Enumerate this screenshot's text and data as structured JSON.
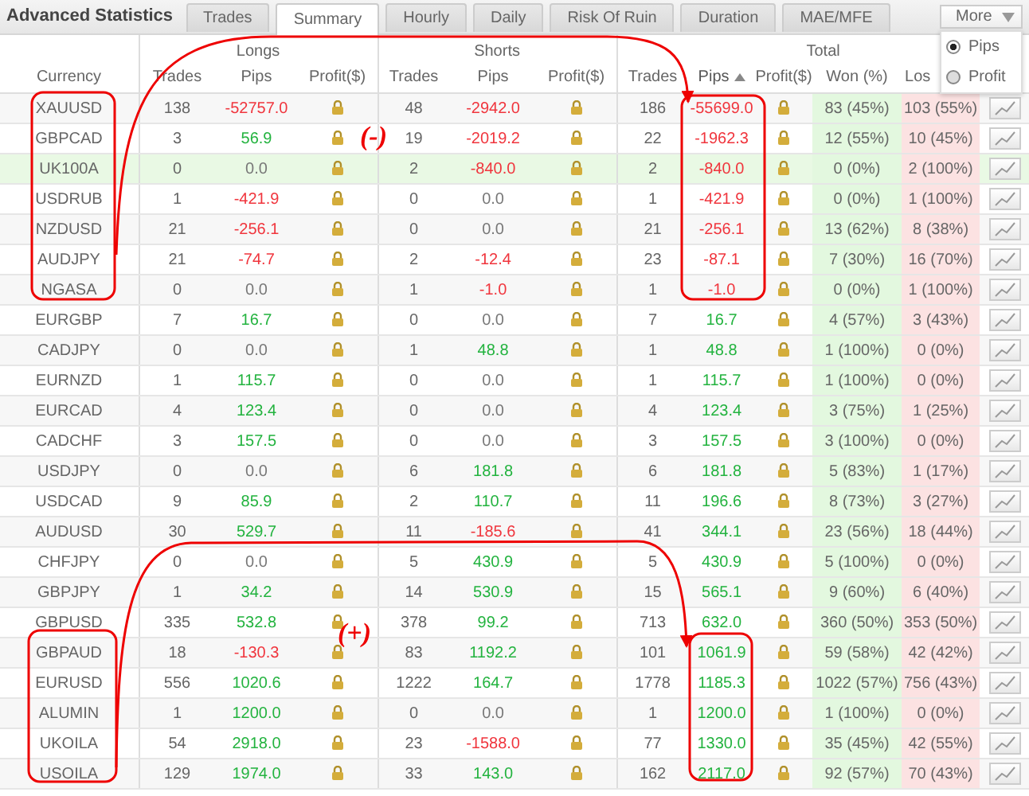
{
  "title": "Advanced Statistics",
  "tabs": [
    {
      "label": "Trades",
      "selected": false
    },
    {
      "label": "Summary",
      "selected": true
    },
    {
      "label": "Hourly",
      "selected": false
    },
    {
      "label": "Daily",
      "selected": false
    },
    {
      "label": "Risk Of Ruin",
      "selected": false
    },
    {
      "label": "Duration",
      "selected": false
    },
    {
      "label": "MAE/MFE",
      "selected": false
    }
  ],
  "more_menu": {
    "label": "More",
    "options": [
      {
        "label": "Pips",
        "selected": true
      },
      {
        "label": "Profit",
        "selected": false
      }
    ]
  },
  "groups": [
    "Longs",
    "Shorts",
    "Total"
  ],
  "columns": {
    "currency": "Currency",
    "longs": [
      "Trades",
      "Pips",
      "Profit($)"
    ],
    "shorts": [
      "Trades",
      "Pips",
      "Profit($)"
    ],
    "total": [
      {
        "label": "Trades",
        "sorted": false
      },
      {
        "label": "Pips",
        "sorted": true
      },
      {
        "label": "Profit($)",
        "sorted": false
      },
      {
        "label": "Won (%)",
        "sorted": false
      },
      {
        "label": "Los",
        "sorted": false
      }
    ]
  },
  "rows": [
    {
      "currency": "XAUUSD",
      "highlighted": false,
      "longs": {
        "trades": "138",
        "pips": "-52757.0",
        "color": "#f0353d"
      },
      "shorts": {
        "trades": "48",
        "pips": "-2942.0",
        "color": "#f0353d"
      },
      "total": {
        "trades": "186",
        "pips": "-55699.0",
        "color": "#f0353d",
        "won": "83 (45%)",
        "lost": "103 (55%)"
      }
    },
    {
      "currency": "GBPCAD",
      "highlighted": false,
      "longs": {
        "trades": "3",
        "pips": "56.9",
        "color": "#23b33f"
      },
      "shorts": {
        "trades": "19",
        "pips": "-2019.2",
        "color": "#f0353d"
      },
      "total": {
        "trades": "22",
        "pips": "-1962.3",
        "color": "#f0353d",
        "won": "12 (55%)",
        "lost": "10 (45%)"
      }
    },
    {
      "currency": "UK100A",
      "highlighted": true,
      "longs": {
        "trades": "0",
        "pips": "0.0",
        "color": "#777777"
      },
      "shorts": {
        "trades": "2",
        "pips": "-840.0",
        "color": "#f0353d"
      },
      "total": {
        "trades": "2",
        "pips": "-840.0",
        "color": "#f0353d",
        "won": "0 (0%)",
        "lost": "2 (100%)"
      }
    },
    {
      "currency": "USDRUB",
      "highlighted": false,
      "longs": {
        "trades": "1",
        "pips": "-421.9",
        "color": "#f0353d"
      },
      "shorts": {
        "trades": "0",
        "pips": "0.0",
        "color": "#777777"
      },
      "total": {
        "trades": "1",
        "pips": "-421.9",
        "color": "#f0353d",
        "won": "0 (0%)",
        "lost": "1 (100%)"
      }
    },
    {
      "currency": "NZDUSD",
      "highlighted": false,
      "longs": {
        "trades": "21",
        "pips": "-256.1",
        "color": "#f0353d"
      },
      "shorts": {
        "trades": "0",
        "pips": "0.0",
        "color": "#777777"
      },
      "total": {
        "trades": "21",
        "pips": "-256.1",
        "color": "#f0353d",
        "won": "13 (62%)",
        "lost": "8 (38%)"
      }
    },
    {
      "currency": "AUDJPY",
      "highlighted": false,
      "longs": {
        "trades": "21",
        "pips": "-74.7",
        "color": "#f0353d"
      },
      "shorts": {
        "trades": "2",
        "pips": "-12.4",
        "color": "#f0353d"
      },
      "total": {
        "trades": "23",
        "pips": "-87.1",
        "color": "#f0353d",
        "won": "7 (30%)",
        "lost": "16 (70%)"
      }
    },
    {
      "currency": "NGASA",
      "highlighted": false,
      "longs": {
        "trades": "0",
        "pips": "0.0",
        "color": "#777777"
      },
      "shorts": {
        "trades": "1",
        "pips": "-1.0",
        "color": "#f0353d"
      },
      "total": {
        "trades": "1",
        "pips": "-1.0",
        "color": "#f0353d",
        "won": "0 (0%)",
        "lost": "1 (100%)"
      }
    },
    {
      "currency": "EURGBP",
      "highlighted": false,
      "longs": {
        "trades": "7",
        "pips": "16.7",
        "color": "#23b33f"
      },
      "shorts": {
        "trades": "0",
        "pips": "0.0",
        "color": "#777777"
      },
      "total": {
        "trades": "7",
        "pips": "16.7",
        "color": "#23b33f",
        "won": "4 (57%)",
        "lost": "3 (43%)"
      }
    },
    {
      "currency": "CADJPY",
      "highlighted": false,
      "longs": {
        "trades": "0",
        "pips": "0.0",
        "color": "#777777"
      },
      "shorts": {
        "trades": "1",
        "pips": "48.8",
        "color": "#23b33f"
      },
      "total": {
        "trades": "1",
        "pips": "48.8",
        "color": "#23b33f",
        "won": "1 (100%)",
        "lost": "0 (0%)"
      }
    },
    {
      "currency": "EURNZD",
      "highlighted": false,
      "longs": {
        "trades": "1",
        "pips": "115.7",
        "color": "#23b33f"
      },
      "shorts": {
        "trades": "0",
        "pips": "0.0",
        "color": "#777777"
      },
      "total": {
        "trades": "1",
        "pips": "115.7",
        "color": "#23b33f",
        "won": "1 (100%)",
        "lost": "0 (0%)"
      }
    },
    {
      "currency": "EURCAD",
      "highlighted": false,
      "longs": {
        "trades": "4",
        "pips": "123.4",
        "color": "#23b33f"
      },
      "shorts": {
        "trades": "0",
        "pips": "0.0",
        "color": "#777777"
      },
      "total": {
        "trades": "4",
        "pips": "123.4",
        "color": "#23b33f",
        "won": "3 (75%)",
        "lost": "1 (25%)"
      }
    },
    {
      "currency": "CADCHF",
      "highlighted": false,
      "longs": {
        "trades": "3",
        "pips": "157.5",
        "color": "#23b33f"
      },
      "shorts": {
        "trades": "0",
        "pips": "0.0",
        "color": "#777777"
      },
      "total": {
        "trades": "3",
        "pips": "157.5",
        "color": "#23b33f",
        "won": "3 (100%)",
        "lost": "0 (0%)"
      }
    },
    {
      "currency": "USDJPY",
      "highlighted": false,
      "longs": {
        "trades": "0",
        "pips": "0.0",
        "color": "#777777"
      },
      "shorts": {
        "trades": "6",
        "pips": "181.8",
        "color": "#23b33f"
      },
      "total": {
        "trades": "6",
        "pips": "181.8",
        "color": "#23b33f",
        "won": "5 (83%)",
        "lost": "1 (17%)"
      }
    },
    {
      "currency": "USDCAD",
      "highlighted": false,
      "longs": {
        "trades": "9",
        "pips": "85.9",
        "color": "#23b33f"
      },
      "shorts": {
        "trades": "2",
        "pips": "110.7",
        "color": "#23b33f"
      },
      "total": {
        "trades": "11",
        "pips": "196.6",
        "color": "#23b33f",
        "won": "8 (73%)",
        "lost": "3 (27%)"
      }
    },
    {
      "currency": "AUDUSD",
      "highlighted": false,
      "longs": {
        "trades": "30",
        "pips": "529.7",
        "color": "#23b33f"
      },
      "shorts": {
        "trades": "11",
        "pips": "-185.6",
        "color": "#f0353d"
      },
      "total": {
        "trades": "41",
        "pips": "344.1",
        "color": "#23b33f",
        "won": "23 (56%)",
        "lost": "18 (44%)"
      }
    },
    {
      "currency": "CHFJPY",
      "highlighted": false,
      "longs": {
        "trades": "0",
        "pips": "0.0",
        "color": "#777777"
      },
      "shorts": {
        "trades": "5",
        "pips": "430.9",
        "color": "#23b33f"
      },
      "total": {
        "trades": "5",
        "pips": "430.9",
        "color": "#23b33f",
        "won": "5 (100%)",
        "lost": "0 (0%)"
      }
    },
    {
      "currency": "GBPJPY",
      "highlighted": false,
      "longs": {
        "trades": "1",
        "pips": "34.2",
        "color": "#23b33f"
      },
      "shorts": {
        "trades": "14",
        "pips": "530.9",
        "color": "#23b33f"
      },
      "total": {
        "trades": "15",
        "pips": "565.1",
        "color": "#23b33f",
        "won": "9 (60%)",
        "lost": "6 (40%)"
      }
    },
    {
      "currency": "GBPUSD",
      "highlighted": false,
      "longs": {
        "trades": "335",
        "pips": "532.8",
        "color": "#23b33f"
      },
      "shorts": {
        "trades": "378",
        "pips": "99.2",
        "color": "#23b33f"
      },
      "total": {
        "trades": "713",
        "pips": "632.0",
        "color": "#23b33f",
        "won": "360 (50%)",
        "lost": "353 (50%)"
      }
    },
    {
      "currency": "GBPAUD",
      "highlighted": false,
      "longs": {
        "trades": "18",
        "pips": "-130.3",
        "color": "#f0353d"
      },
      "shorts": {
        "trades": "83",
        "pips": "1192.2",
        "color": "#23b33f"
      },
      "total": {
        "trades": "101",
        "pips": "1061.9",
        "color": "#23b33f",
        "won": "59 (58%)",
        "lost": "42 (42%)"
      }
    },
    {
      "currency": "EURUSD",
      "highlighted": false,
      "longs": {
        "trades": "556",
        "pips": "1020.6",
        "color": "#23b33f"
      },
      "shorts": {
        "trades": "1222",
        "pips": "164.7",
        "color": "#23b33f"
      },
      "total": {
        "trades": "1778",
        "pips": "1185.3",
        "color": "#23b33f",
        "won": "1022 (57%)",
        "lost": "756 (43%)"
      }
    },
    {
      "currency": "ALUMIN",
      "highlighted": false,
      "longs": {
        "trades": "1",
        "pips": "1200.0",
        "color": "#23b33f"
      },
      "shorts": {
        "trades": "0",
        "pips": "0.0",
        "color": "#777777"
      },
      "total": {
        "trades": "1",
        "pips": "1200.0",
        "color": "#23b33f",
        "won": "1 (100%)",
        "lost": "0 (0%)"
      }
    },
    {
      "currency": "UKOILA",
      "highlighted": false,
      "longs": {
        "trades": "54",
        "pips": "2918.0",
        "color": "#23b33f"
      },
      "shorts": {
        "trades": "23",
        "pips": "-1588.0",
        "color": "#f0353d"
      },
      "total": {
        "trades": "77",
        "pips": "1330.0",
        "color": "#23b33f",
        "won": "35 (45%)",
        "lost": "42 (55%)"
      }
    },
    {
      "currency": "USOILA",
      "highlighted": false,
      "longs": {
        "trades": "129",
        "pips": "1974.0",
        "color": "#23b33f"
      },
      "shorts": {
        "trades": "33",
        "pips": "143.0",
        "color": "#23b33f"
      },
      "total": {
        "trades": "162",
        "pips": "2117.0",
        "color": "#23b33f",
        "won": "92 (57%)",
        "lost": "70 (43%)"
      }
    }
  ],
  "annotations": [
    {
      "text": "(-)"
    },
    {
      "text": "(+)"
    }
  ]
}
